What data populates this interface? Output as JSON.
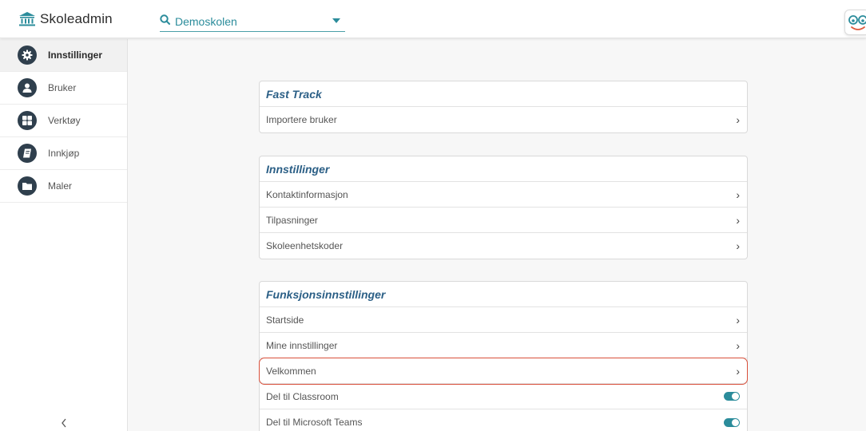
{
  "header": {
    "brand_name": "Skoleadmin",
    "brand_icon": "institution-icon",
    "school_select": {
      "value": "Demoskolen",
      "icon": "search-icon"
    },
    "logo": "eyes-logo-icon"
  },
  "sidebar": {
    "items": [
      {
        "label": "Innstillinger",
        "icon": "gear-icon",
        "active": true
      },
      {
        "label": "Bruker",
        "icon": "user-icon"
      },
      {
        "label": "Verktøy",
        "icon": "grid-icon"
      },
      {
        "label": "Innkjøp",
        "icon": "book-icon"
      },
      {
        "label": "Maler",
        "icon": "folder-icon"
      }
    ],
    "collapse_icon": "chevron-left-icon"
  },
  "sections": [
    {
      "title": "Fast Track",
      "rows": [
        {
          "label": "Importere bruker",
          "control": "chevron"
        }
      ]
    },
    {
      "title": "Innstillinger",
      "rows": [
        {
          "label": "Kontaktinformasjon",
          "control": "chevron"
        },
        {
          "label": "Tilpasninger",
          "control": "chevron"
        },
        {
          "label": "Skoleenhetskoder",
          "control": "chevron"
        }
      ]
    },
    {
      "title": "Funksjonsinnstillinger",
      "rows": [
        {
          "label": "Startside",
          "control": "chevron"
        },
        {
          "label": "Mine innstillinger",
          "control": "chevron"
        },
        {
          "label": "Velkommen",
          "control": "chevron",
          "highlighted": true
        },
        {
          "label": "Del til Classroom",
          "control": "toggle",
          "on": true
        },
        {
          "label": "Del til Microsoft Teams",
          "control": "toggle",
          "on": true
        }
      ]
    }
  ],
  "colors": {
    "accent": "#2b8c9b",
    "section_title": "#2b5f86",
    "highlight": "#d9503b",
    "sidebar_icon": "#2f3f4d"
  }
}
